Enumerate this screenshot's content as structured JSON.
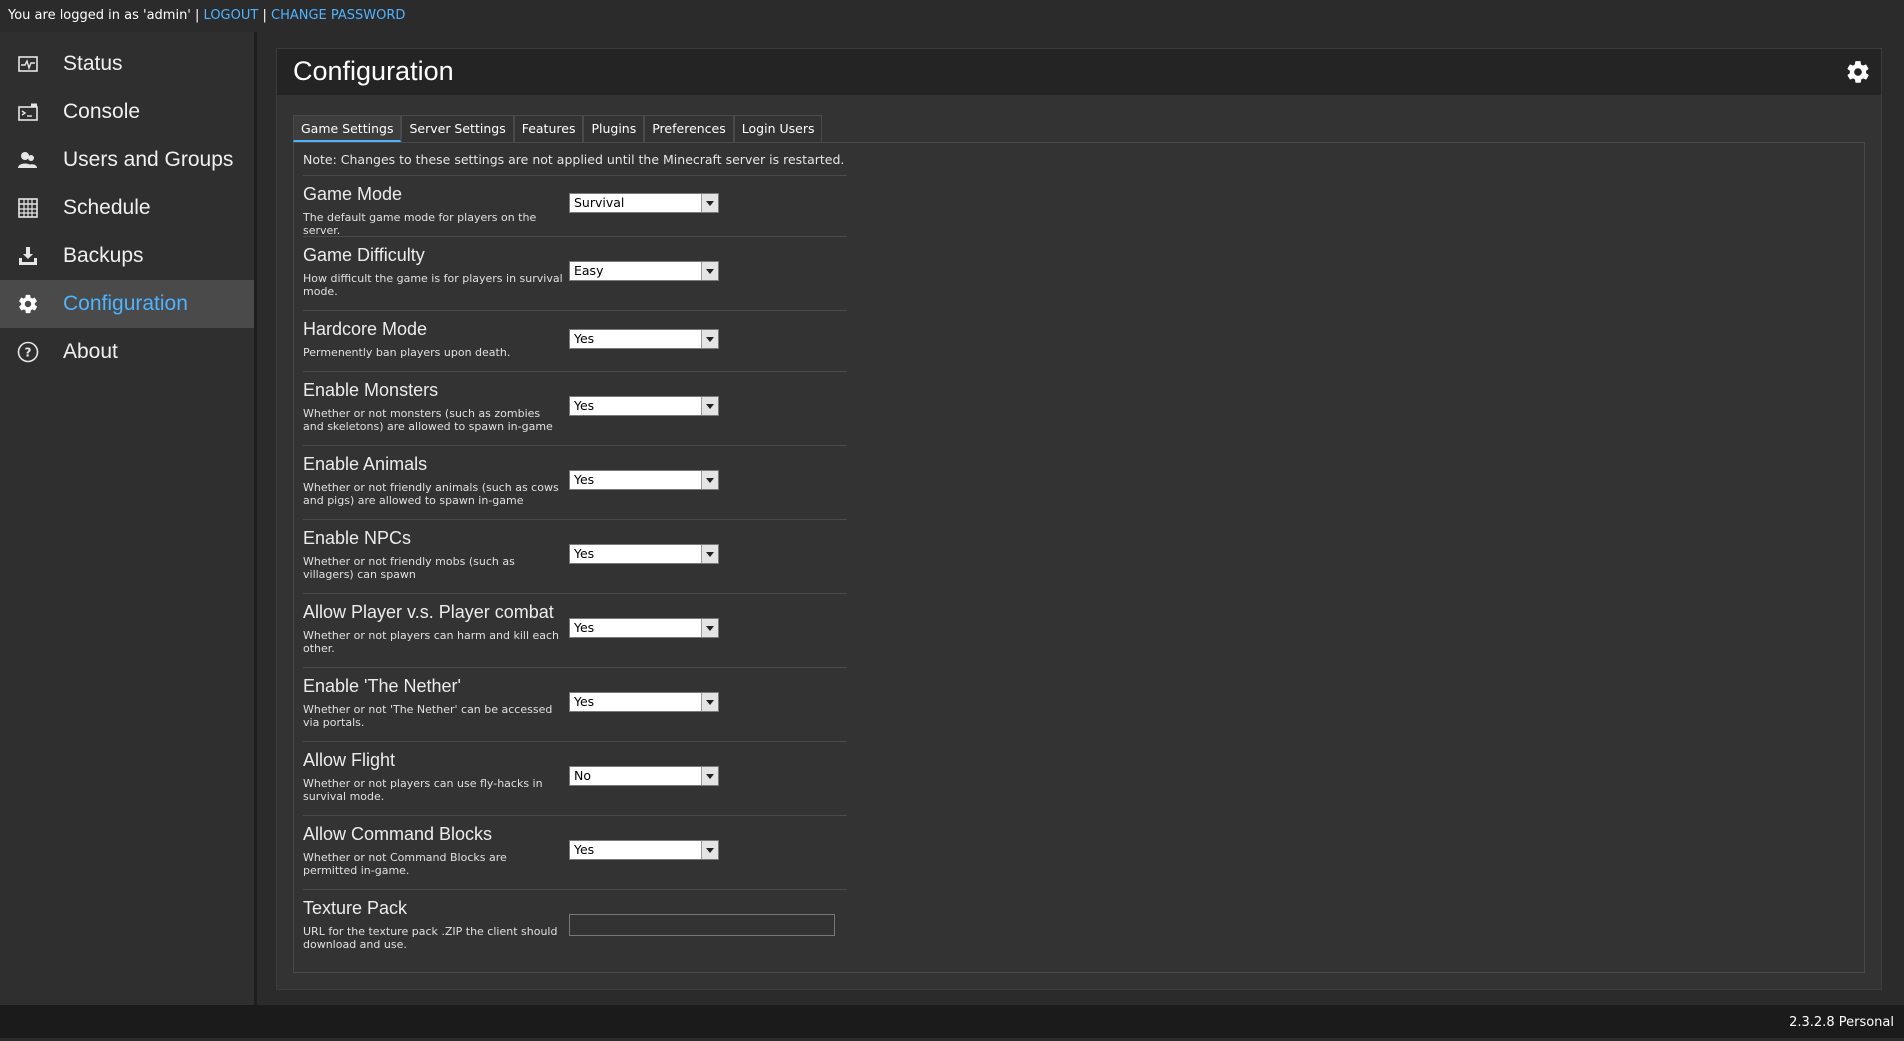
{
  "topbar": {
    "logged_in_text": "You are logged in as 'admin' |",
    "logout": "LOGOUT",
    "separator": "|",
    "change_password": "CHANGE PASSWORD"
  },
  "sidebar": {
    "items": [
      {
        "label": "Status",
        "icon": "status-icon"
      },
      {
        "label": "Console",
        "icon": "console-icon"
      },
      {
        "label": "Users and Groups",
        "icon": "users-icon"
      },
      {
        "label": "Schedule",
        "icon": "schedule-icon"
      },
      {
        "label": "Backups",
        "icon": "backup-icon"
      },
      {
        "label": "Configuration",
        "icon": "gear-icon",
        "active": true
      },
      {
        "label": "About",
        "icon": "help-icon"
      }
    ]
  },
  "main": {
    "title": "Configuration",
    "tabs": [
      "Game Settings",
      "Server Settings",
      "Features",
      "Plugins",
      "Preferences",
      "Login Users"
    ],
    "active_tab": "Game Settings",
    "note": "Note: Changes to these settings are not applied until the Minecraft server is restarted.",
    "settings": [
      {
        "title": "Game Mode",
        "desc": "The default game mode for players on the server.",
        "value": "Survival"
      },
      {
        "title": "Game Difficulty",
        "desc": "How difficult the game is for players in survival mode.",
        "value": "Easy"
      },
      {
        "title": "Hardcore Mode",
        "desc": "Permenently ban players upon death.",
        "value": "Yes"
      },
      {
        "title": "Enable Monsters",
        "desc": "Whether or not monsters (such as zombies and skeletons) are allowed to spawn in-game",
        "value": "Yes"
      },
      {
        "title": "Enable Animals",
        "desc": "Whether or not friendly animals (such as cows and pigs) are allowed to spawn in-game",
        "value": "Yes"
      },
      {
        "title": "Enable NPCs",
        "desc": "Whether or not friendly mobs (such as villagers) can spawn",
        "value": "Yes"
      },
      {
        "title": "Allow Player v.s. Player combat",
        "desc": "Whether or not players can harm and kill each other.",
        "value": "Yes"
      },
      {
        "title": "Enable 'The Nether'",
        "desc": "Whether or not 'The Nether' can be accessed via portals.",
        "value": "Yes"
      },
      {
        "title": "Allow Flight",
        "desc": "Whether or not players can use fly-hacks in survival mode.",
        "value": "No"
      },
      {
        "title": "Allow Command Blocks",
        "desc": "Whether or not Command Blocks are permitted in-game.",
        "value": "Yes"
      },
      {
        "title": "Texture Pack",
        "desc": "URL for the texture pack .ZIP the client should download and use.",
        "value": ""
      }
    ]
  },
  "footer": {
    "version": "2.3.2.8 Personal"
  },
  "colors": {
    "accent": "#4fb3ff",
    "background": "#2b2b2b",
    "panel": "#333333",
    "header": "#242424"
  }
}
